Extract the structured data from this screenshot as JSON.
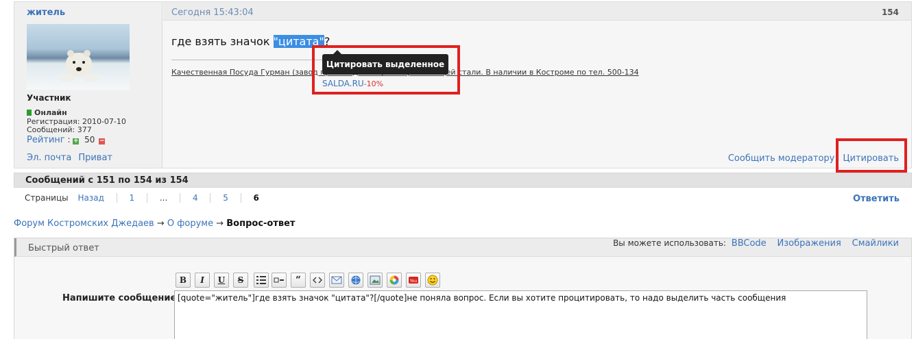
{
  "post": {
    "author": "житель",
    "role": "Участник",
    "online": "Онлайн",
    "registration": "Регистрация: 2010-07-10",
    "messages": "Сообщений: 377",
    "rating_label": "Рейтинг",
    "rating_sep": " : ",
    "rating_value": "50",
    "email_link": "Эл. почта",
    "private_link": "Приват",
    "date": "Сегодня 15:43:04",
    "number": "154",
    "text_before": "где взять значок ",
    "text_selected": "\"цитата\"",
    "text_after": "?",
    "sig_ad": "Качественная Посуда Гурман (завод производитель) из нержавеющей стали. В наличии в Костроме по тел. 500-134",
    "sig_site": "SALDA.RU",
    "sig_discount": "-10%",
    "tooltip": "Цитировать выделенное",
    "report_link": "Сообщить модератору",
    "quote_link": "Цитировать"
  },
  "pagination": {
    "count_text": "Сообщений с 151 по 154 из 154",
    "pages_label": "Страницы",
    "back": "Назад",
    "pages": [
      "1",
      "...",
      "4",
      "5"
    ],
    "current": "6",
    "reply": "Ответить"
  },
  "breadcrumb": {
    "forum": "Форум Костромских Джедаев",
    "section": "О форуме",
    "topic": "Вопрос-ответ",
    "arrow": "→"
  },
  "quick_reply": {
    "title": "Быстрый ответ",
    "can_use": "Вы можете использовать:",
    "bbcode": "BBCode",
    "images": "Изображения",
    "smilies": "Смайлики",
    "message_label": "Напишите сообщение",
    "message_value": "[quote=\"житель\"]где взять значок \"цитата\"?[/quote]не поняла вопрос. Если вы хотите процитировать, то надо выделить часть сообщения",
    "toolbar": {
      "bold": "B",
      "italic": "I",
      "underline": "U",
      "strike": "S",
      "quote": "“"
    },
    "toolbar_icons": [
      "bold-icon",
      "italic-icon",
      "underline-icon",
      "strikethrough-icon",
      "list-icon",
      "list-item-icon",
      "quote-icon",
      "code-icon",
      "email-icon",
      "link-icon",
      "image-icon",
      "color-icon",
      "youtube-icon",
      "smiley-icon"
    ]
  },
  "colors": {
    "link": "#3b73b9",
    "highlight": "#e02020",
    "online": "#2d9c2d"
  }
}
